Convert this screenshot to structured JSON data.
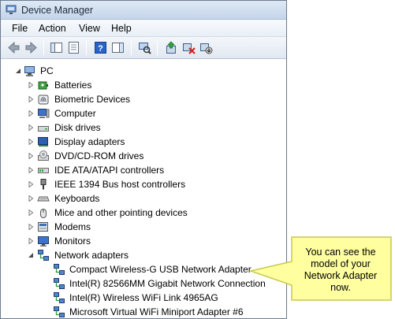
{
  "window": {
    "title": "Device Manager"
  },
  "menu": [
    "File",
    "Action",
    "View",
    "Help"
  ],
  "toolbar": {
    "buttons": [
      "back-icon",
      "forward-icon",
      "show-hide-tree-icon",
      "properties-icon",
      "help-icon",
      "action-pane-icon",
      "scan-hardware-icon",
      "update-driver-icon",
      "uninstall-icon",
      "disable-icon"
    ]
  },
  "tree": {
    "root": "PC",
    "categories": [
      "Batteries",
      "Biometric Devices",
      "Computer",
      "Disk drives",
      "Display adapters",
      "DVD/CD-ROM drives",
      "IDE ATA/ATAPI controllers",
      "IEEE 1394 Bus host controllers",
      "Keyboards",
      "Mice and other pointing devices",
      "Modems",
      "Monitors",
      "Network adapters"
    ],
    "network_adapters": [
      "Compact Wireless-G USB Network Adapter",
      "Intel(R) 82566MM Gigabit Network Connection",
      "Intel(R) Wireless WiFi Link 4965AG",
      "Microsoft Virtual WiFi Miniport Adapter #6"
    ]
  },
  "callout": {
    "lines": [
      "You can see the",
      "model of your",
      "Network Adapter",
      "now."
    ],
    "color": "#ffffa0",
    "border_color": "#c9c94a"
  }
}
